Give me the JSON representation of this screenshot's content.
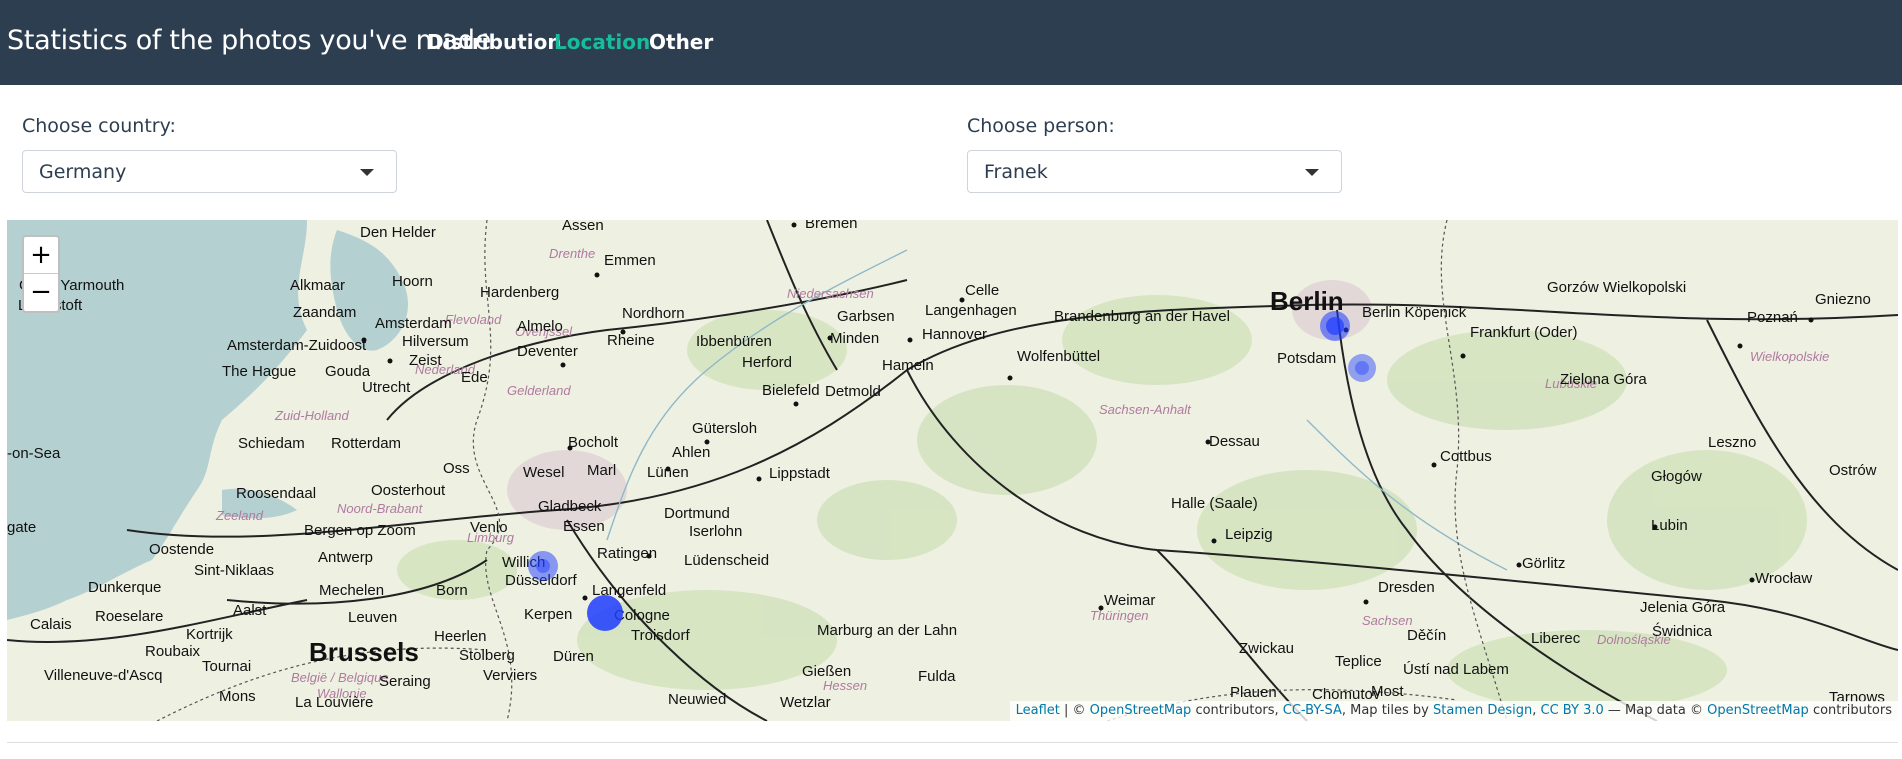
{
  "navbar": {
    "brand": "Statistics of the photos you've made",
    "links": [
      {
        "label": "Distribution",
        "active": false
      },
      {
        "label": "Location",
        "active": true
      },
      {
        "label": "Other",
        "active": false
      }
    ]
  },
  "controls": {
    "country_label": "Choose country:",
    "country_value": "Germany",
    "person_label": "Choose person:",
    "person_value": "Franek"
  },
  "map": {
    "zoom_in": "+",
    "zoom_out": "−",
    "attribution": {
      "leaflet": "Leaflet",
      "sep1": " | © ",
      "osm": "OpenStreetMap",
      "contrib1": " contributors, ",
      "ccbysa": "CC-BY-SA",
      "tiles": ", Map tiles by ",
      "stamen": "Stamen Design",
      "comma": ", ",
      "ccby": "CC BY 3.0",
      "dash": " — Map data © ",
      "osm2": "OpenStreetMap",
      "contrib2": " contributors"
    },
    "cities": [
      "Den Helder",
      "Assen",
      "Bremen",
      "Emmen",
      "Celle",
      "Gorzów Wielkopolski",
      "Great Yarmouth",
      "Alkmaar",
      "Hoorn",
      "Lowestoft",
      "Hardenberg",
      "Zaandam",
      "Amsterdam",
      "Nordhorn",
      "Garbsen",
      "Langenhagen",
      "Brandenburg an der Havel",
      "Berlin",
      "Berlin Köpenick",
      "Gniezno",
      "Almelo",
      "Rheine",
      "Ibbenbüren",
      "Minden",
      "Hannover",
      "Frankfurt (Oder)",
      "Poznań",
      "Amsterdam-Zuidoost",
      "Hilversum",
      "Zeist",
      "Deventer",
      "Herford",
      "Wolfenbüttel",
      "Potsdam",
      "The Hague",
      "Gouda",
      "Ede",
      "Hameln",
      "Utrecht",
      "Bielefeld",
      "Detmold",
      "Zielona Góra",
      "Schiedam",
      "Rotterdam",
      "Bocholt",
      "Gütersloh",
      "Dessau",
      "Cottbus",
      "Leszno",
      "-on-Sea",
      "Oss",
      "Wesel",
      "Marl",
      "Ahlen",
      "Lünen",
      "Lippstadt",
      "Głogów",
      "Ostrów",
      "Roosendaal",
      "Oosterhout",
      "Gladbeck",
      "Dortmund",
      "Halle (Saale)",
      "Lubin",
      "gate",
      "Bergen op Zoom",
      "Venlo",
      "Essen",
      "Iserlohn",
      "Leipzig",
      "Oostende",
      "Antwerp",
      "Sint-Niklaas",
      "Willich",
      "Ratingen",
      "Lüdenscheid",
      "Görlitz",
      "Wrocław",
      "Dunkerque",
      "Mechelen",
      "Düsseldorf",
      "Langenfeld",
      "Dresden",
      "Calais",
      "Aalst",
      "Born",
      "Weimar",
      "Jelenia Góra",
      "Roeselare",
      "Leuven",
      "Kerpen",
      "Cologne",
      "Troisdorf",
      "Kortrijk",
      "Heerlen",
      "Marburg an der Lahn",
      "Zwickau",
      "Děčín",
      "Liberec",
      "Świdnica",
      "Brussels",
      "Stolberg",
      "Düren",
      "Teplice",
      "Roubaix",
      "Tournai",
      "Seraing",
      "Verviers",
      "Gießen",
      "Fulda",
      "Ústí nad Labem",
      "Villeneuve-d'Ascq",
      "Mons",
      "La Louvière",
      "Neuwied",
      "Wetzlar",
      "Plauen",
      "Chomutov",
      "Most",
      "Tarnows"
    ],
    "regions": [
      "Niedersachsen",
      "Drenthe",
      "Overijssel",
      "Flevoland",
      "Gelderland",
      "Nederland",
      "Zuid-Holland",
      "Noord-Brabant",
      "Zeeland",
      "Sachsen-Anhalt",
      "Sachsen",
      "Hessen",
      "Thüringen",
      "Lubuskie",
      "Wielkopolskie",
      "Dolnośląskie",
      "Limburg",
      "België / Belgique",
      "Wallonie"
    ],
    "markers": [
      {
        "city": "Berlin",
        "count": 2
      },
      {
        "city": "Berlin Köpenick",
        "count": 1
      },
      {
        "city": "Düsseldorf",
        "count": 1
      },
      {
        "city": "Cologne",
        "count": 3
      }
    ]
  },
  "colors": {
    "navbar_bg": "#2c3e50",
    "accent": "#18bc9c",
    "marker": "#1e3cff",
    "water": "#b5d0d0",
    "land": "#eef0e2"
  }
}
